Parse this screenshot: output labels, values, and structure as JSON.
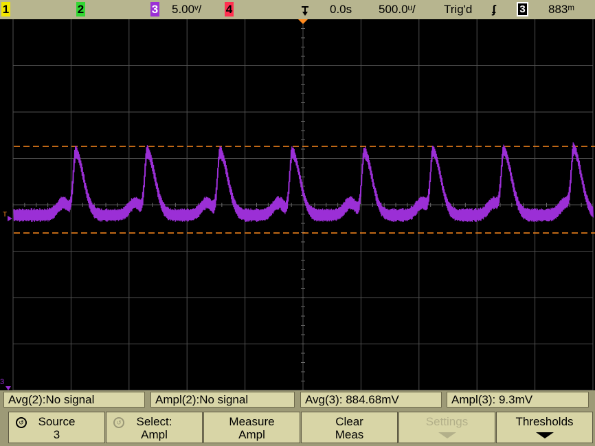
{
  "topbar": {
    "ch1": "1",
    "ch2": "2",
    "ch3": "3",
    "ch3_scale": "5.00ᵛ/",
    "ch4": "4",
    "time_ref_icon": "trigger-point-icon",
    "time_delay": "0.0s",
    "time_scale": "500.0ᵘ/",
    "trigger_status": "Trig'd",
    "trigger_slope": "ʄ",
    "trigger_source": "3",
    "trigger_level": "883ᵐ"
  },
  "colors": {
    "ch1": "#f2e600",
    "ch2": "#33d633",
    "ch3": "#9b2fd6",
    "ch4": "#ff3050",
    "trigger": "#ff8a1e",
    "grid": "#505050"
  },
  "screen": {
    "ch3_ground_label": "3",
    "trigger_marker_label": "T"
  },
  "measurements": [
    {
      "label": "Avg(2):No signal"
    },
    {
      "label": "Ampl(2):No signal"
    },
    {
      "label": "Avg(3): 884.68mV"
    },
    {
      "label": "Ampl(3): 9.3mV"
    }
  ],
  "softkeys": [
    {
      "line1": "Source",
      "line2": "3"
    },
    {
      "line1": "Select:",
      "line2": "Ampl"
    },
    {
      "line1": "Measure",
      "line2": "Ampl"
    },
    {
      "line1": "Clear",
      "line2": "Meas"
    },
    {
      "line1": "Settings",
      "line2": ""
    },
    {
      "line1": "Thresholds",
      "line2": ""
    }
  ]
}
